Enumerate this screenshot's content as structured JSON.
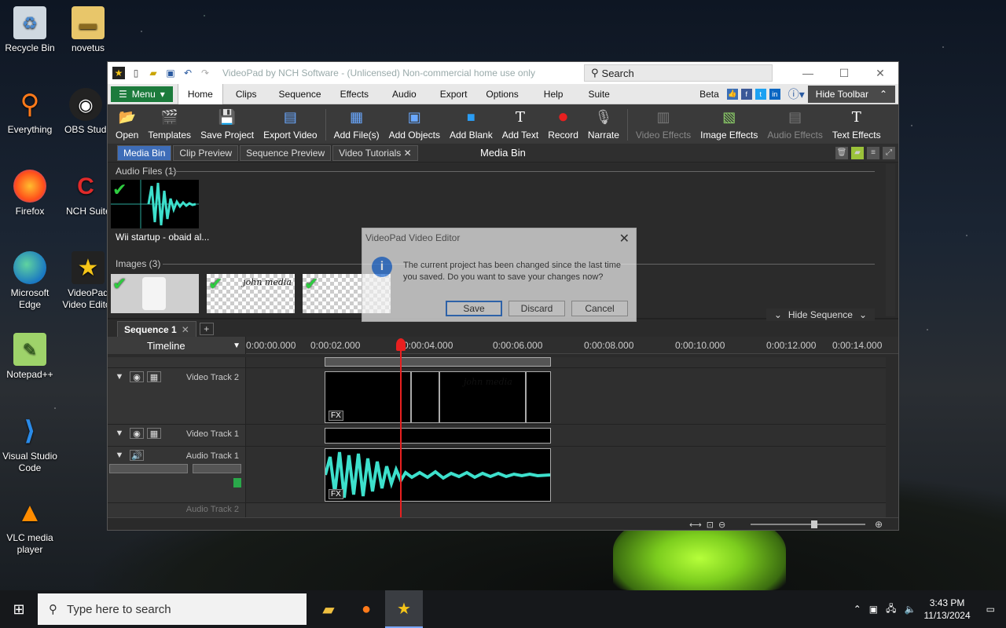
{
  "desktop": {
    "icons": [
      {
        "label": "Recycle Bin"
      },
      {
        "label": "novetus"
      },
      {
        "label": "Everything"
      },
      {
        "label": "OBS Studio"
      },
      {
        "label": "Firefox"
      },
      {
        "label": "NCH Suite"
      },
      {
        "label": "Microsoft Edge"
      },
      {
        "label": "VideoPad Video Editor"
      },
      {
        "label": "Notepad++"
      },
      {
        "label": "Visual Studio Code"
      },
      {
        "label": "VLC media player"
      }
    ]
  },
  "window": {
    "title": "VideoPad by NCH Software - (Unlicensed) Non-commercial home use only",
    "search_label": "Search"
  },
  "menubar": {
    "menu_label": "Menu",
    "tabs": [
      "Home",
      "Clips",
      "Sequence",
      "Effects",
      "Audio",
      "Export",
      "Options",
      "Help",
      "Suite"
    ],
    "beta": "Beta",
    "hide_toolbar": "Hide Toolbar"
  },
  "toolbar": {
    "buttons": [
      "Open",
      "Templates",
      "Save Project",
      "Export Video",
      "Add File(s)",
      "Add Objects",
      "Add Blank",
      "Add Text",
      "Record",
      "Narrate",
      "Video Effects",
      "Image Effects",
      "Audio Effects",
      "Text Effects"
    ]
  },
  "bin": {
    "tabs": [
      "Media Bin",
      "Clip Preview",
      "Sequence Preview",
      "Video Tutorials"
    ],
    "title": "Media Bin",
    "audio_section": "Audio Files (1)",
    "audio_item": "Wii startup - obaid al...",
    "images_section": "Images (3)",
    "image_text": "john media"
  },
  "sequence": {
    "tab": "Sequence 1",
    "hide_sequence": "Hide Sequence",
    "timeline_label": "Timeline",
    "ruler": [
      "0:00:00.000",
      "0:00:02.000",
      "0:00:04.000",
      "0:00:06.000",
      "0:00:08.000",
      "0:00:10.000",
      "0:00:12.000",
      "0:00:14.000"
    ],
    "tracks": [
      "Video Track 2",
      "Video Track 1",
      "Audio Track 1",
      "Audio Track 2"
    ],
    "clip_text": "john media",
    "fx": "FX"
  },
  "dialog": {
    "title": "VideoPad Video Editor",
    "message": "The current project has been changed since the last time you saved. Do you want to save your changes now?",
    "buttons": [
      "Save",
      "Discard",
      "Cancel"
    ]
  },
  "taskbar": {
    "search_placeholder": "Type here to search",
    "time": "3:43 PM",
    "date": "11/13/2024"
  }
}
